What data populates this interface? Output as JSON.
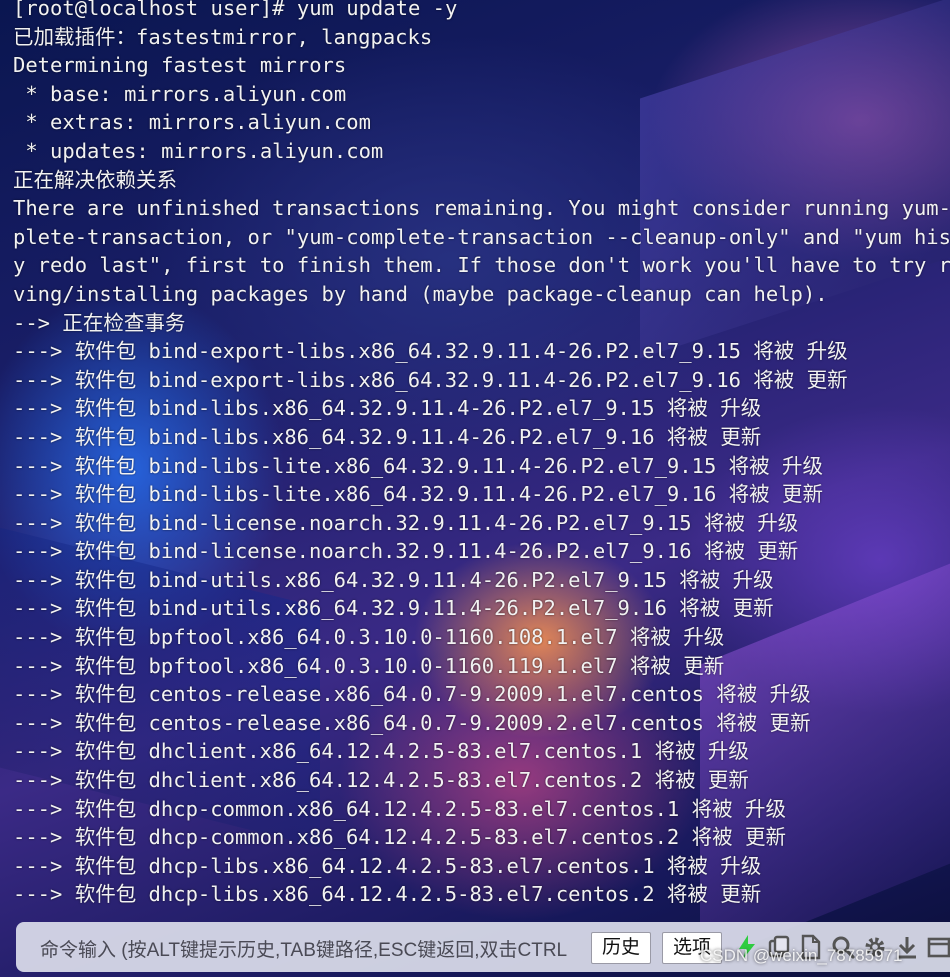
{
  "terminal": {
    "lines": [
      "[root@localhost user]# yum update -y",
      "已加载插件：fastestmirror, langpacks",
      "Determining fastest mirrors",
      " * base: mirrors.aliyun.com",
      " * extras: mirrors.aliyun.com",
      " * updates: mirrors.aliyun.com",
      "正在解决依赖关系",
      "There are unfinished transactions remaining. You might consider running yum-co",
      "plete-transaction, or \"yum-complete-transaction --cleanup-only\" and \"yum histo",
      "y redo last\", first to finish them. If those don't work you'll have to try rem",
      "ving/installing packages by hand (maybe package-cleanup can help).",
      "--> 正在检查事务",
      "---> 软件包 bind-export-libs.x86_64.32.9.11.4-26.P2.el7_9.15 将被 升级",
      "---> 软件包 bind-export-libs.x86_64.32.9.11.4-26.P2.el7_9.16 将被 更新",
      "---> 软件包 bind-libs.x86_64.32.9.11.4-26.P2.el7_9.15 将被 升级",
      "---> 软件包 bind-libs.x86_64.32.9.11.4-26.P2.el7_9.16 将被 更新",
      "---> 软件包 bind-libs-lite.x86_64.32.9.11.4-26.P2.el7_9.15 将被 升级",
      "---> 软件包 bind-libs-lite.x86_64.32.9.11.4-26.P2.el7_9.16 将被 更新",
      "---> 软件包 bind-license.noarch.32.9.11.4-26.P2.el7_9.15 将被 升级",
      "---> 软件包 bind-license.noarch.32.9.11.4-26.P2.el7_9.16 将被 更新",
      "---> 软件包 bind-utils.x86_64.32.9.11.4-26.P2.el7_9.15 将被 升级",
      "---> 软件包 bind-utils.x86_64.32.9.11.4-26.P2.el7_9.16 将被 更新",
      "---> 软件包 bpftool.x86_64.0.3.10.0-1160.108.1.el7 将被 升级",
      "---> 软件包 bpftool.x86_64.0.3.10.0-1160.119.1.el7 将被 更新",
      "---> 软件包 centos-release.x86_64.0.7-9.2009.1.el7.centos 将被 升级",
      "---> 软件包 centos-release.x86_64.0.7-9.2009.2.el7.centos 将被 更新",
      "---> 软件包 dhclient.x86_64.12.4.2.5-83.el7.centos.1 将被 升级",
      "---> 软件包 dhclient.x86_64.12.4.2.5-83.el7.centos.2 将被 更新",
      "---> 软件包 dhcp-common.x86_64.12.4.2.5-83.el7.centos.1 将被 升级",
      "---> 软件包 dhcp-common.x86_64.12.4.2.5-83.el7.centos.2 将被 更新",
      "---> 软件包 dhcp-libs.x86_64.12.4.2.5-83.el7.centos.1 将被 升级",
      "---> 软件包 dhcp-libs.x86_64.12.4.2.5-83.el7.centos.2 将被 更新"
    ]
  },
  "command_bar": {
    "hint": "命令输入 (按ALT键提示历史,TAB键路径,ESC键返回,双击CTRL",
    "history_label": "历史",
    "options_label": "选项",
    "icons": [
      "lightning-icon",
      "copy-icon",
      "file-icon",
      "search-icon",
      "gear-icon",
      "download-icon",
      "window-icon"
    ]
  },
  "watermark": "CSDN @weixin_78785971",
  "colors": {
    "terminal_text": "#f2f2f2",
    "lightning": "#2ecc40"
  }
}
